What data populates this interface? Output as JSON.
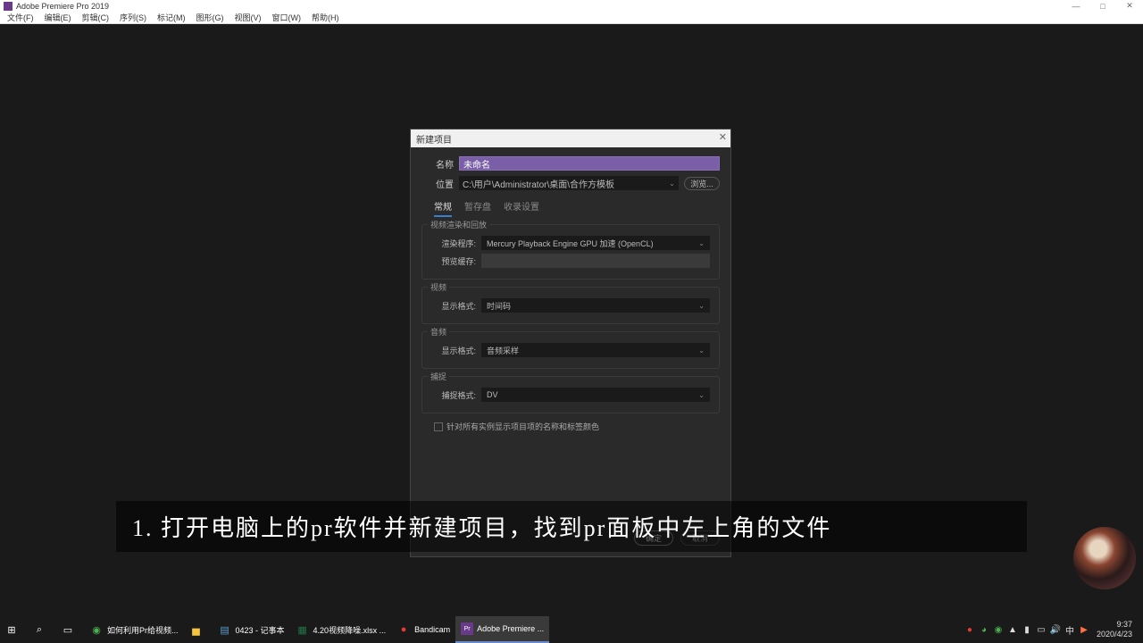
{
  "app": {
    "title": "Adobe Premiere Pro 2019"
  },
  "menu": {
    "file": "文件(F)",
    "edit": "编辑(E)",
    "clip": "剪辑(C)",
    "sequence": "序列(S)",
    "marker": "标记(M)",
    "graphic": "图形(G)",
    "view": "视图(V)",
    "window": "窗口(W)",
    "help": "帮助(H)"
  },
  "dialog": {
    "title": "新建项目",
    "name_label": "名称",
    "name_value": "未命名",
    "location_label": "位置",
    "location_value": "C:\\用户\\Administrator\\桌面\\合作方模板",
    "browse": "浏览...",
    "tabs": {
      "general": "常规",
      "scratch": "暂存盘",
      "ingest": "收录设置"
    },
    "video_render_section": "视频渲染和回放",
    "renderer_label": "渲染程序:",
    "renderer_value": "Mercury Playback Engine GPU 加速 (OpenCL)",
    "preview_cache_label": "预览缓存:",
    "video_section": "视频",
    "video_display_label": "显示格式:",
    "video_display_value": "时间码",
    "audio_section": "音频",
    "audio_display_label": "显示格式:",
    "audio_display_value": "音频采样",
    "capture_section": "捕捉",
    "capture_format_label": "捕捉格式:",
    "capture_format_value": "DV",
    "checkbox_label": "针对所有实例显示项目项的名称和标签颜色",
    "ok": "确定",
    "cancel": "取消"
  },
  "caption": "1. 打开电脑上的pr软件并新建项目，找到pr面板中左上角的文件",
  "taskbar": {
    "items": [
      {
        "label": "如何利用Pr给视频..."
      },
      {
        "label": "0423 - 记事本"
      },
      {
        "label": "4.20视频降噪.xlsx ..."
      },
      {
        "label": "Bandicam"
      },
      {
        "label": "Adobe Premiere ..."
      }
    ],
    "ime": "中",
    "time": "9:37",
    "date": "2020/4/23"
  }
}
